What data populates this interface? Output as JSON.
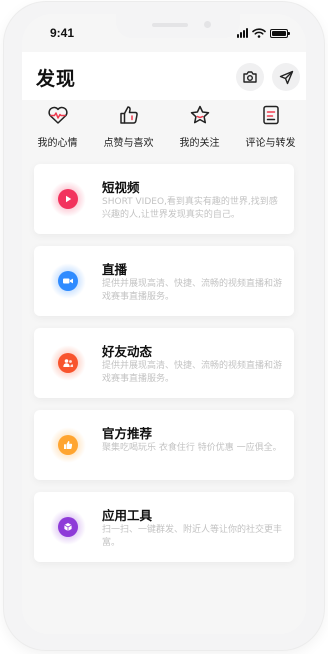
{
  "status_bar": {
    "time": "9:41"
  },
  "header": {
    "title": "发现"
  },
  "quick_links": [
    {
      "label": "我的心情",
      "icon": "heart-pulse-icon"
    },
    {
      "label": "点赞与喜欢",
      "icon": "thumbs-up-icon"
    },
    {
      "label": "我的关注",
      "icon": "star-icon"
    },
    {
      "label": "评论与转发",
      "icon": "comment-doc-icon"
    }
  ],
  "cards": [
    {
      "title": "短视频",
      "desc": "SHORT VIDEO,看到真实有趣的世界,找到感兴趣的人,让世界发现真实的自己。",
      "icon": "play-icon",
      "color": "#f2335d"
    },
    {
      "title": "直播",
      "desc": "提供并展现高清、快捷、流畅的视频直播和游戏赛事直播服务。",
      "icon": "video-camera-icon",
      "color": "#2f8bff"
    },
    {
      "title": "好友动态",
      "desc": "提供并展现高清、快捷、流畅的视频直播和游戏赛事直播服务。",
      "icon": "friends-icon",
      "color": "#f8542d"
    },
    {
      "title": "官方推荐",
      "desc": "聚集吃喝玩乐 衣食住行 特价优惠 一应俱全。",
      "icon": "thumbs-up-icon",
      "color": "#ffa531"
    },
    {
      "title": "应用工具",
      "desc": "扫一扫、一键群发、附近人等让你的社交更丰富。",
      "icon": "cube-icon",
      "color": "#8e3bd8"
    }
  ],
  "colors": {
    "accent_red": "#ef3b4f",
    "outline": "#222222"
  }
}
